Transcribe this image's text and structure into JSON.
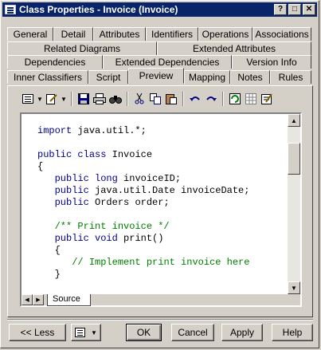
{
  "window": {
    "title": "Class Properties - Invoice (Invoice)",
    "controls": {
      "help": "?",
      "maximize": "□",
      "close": "✕"
    }
  },
  "tabs": {
    "row1": [
      "General",
      "Detail",
      "Attributes",
      "Identifiers",
      "Operations",
      "Associations"
    ],
    "row2": [
      "Related Diagrams",
      "Extended Attributes"
    ],
    "row3": [
      "Dependencies",
      "Extended Dependencies",
      "Version Info"
    ],
    "row4": [
      "Inner Classifiers",
      "Script",
      "Preview",
      "Mapping",
      "Notes",
      "Rules"
    ],
    "active": "Preview"
  },
  "toolbar": {
    "icons": [
      "list-menu-icon",
      "edit-menu-icon",
      "save-icon",
      "print-icon",
      "find-icon",
      "cut-icon",
      "copy-icon",
      "paste-icon",
      "undo-icon",
      "redo-icon",
      "refresh-icon",
      "grid-icon",
      "properties-icon"
    ]
  },
  "code": {
    "lines": [
      {
        "parts": [
          [
            "kw",
            "import"
          ],
          [
            "t",
            " java.util.*;"
          ]
        ]
      },
      {
        "parts": [
          [
            "t",
            ""
          ]
        ]
      },
      {
        "parts": [
          [
            "kw",
            "public"
          ],
          [
            "t",
            " "
          ],
          [
            "kw",
            "class"
          ],
          [
            "t",
            " Invoice"
          ]
        ]
      },
      {
        "parts": [
          [
            "t",
            "{"
          ]
        ]
      },
      {
        "parts": [
          [
            "t",
            "   "
          ],
          [
            "kw",
            "public"
          ],
          [
            "t",
            " "
          ],
          [
            "kw",
            "long"
          ],
          [
            "t",
            " invoiceID;"
          ]
        ]
      },
      {
        "parts": [
          [
            "t",
            "   "
          ],
          [
            "kw",
            "public"
          ],
          [
            "t",
            " java.util.Date invoiceDate;"
          ]
        ]
      },
      {
        "parts": [
          [
            "t",
            "   "
          ],
          [
            "kw",
            "public"
          ],
          [
            "t",
            " Orders order;"
          ]
        ]
      },
      {
        "parts": [
          [
            "t",
            ""
          ]
        ]
      },
      {
        "parts": [
          [
            "t",
            "   "
          ],
          [
            "cm",
            "/** Print invoice */"
          ]
        ]
      },
      {
        "parts": [
          [
            "t",
            "   "
          ],
          [
            "kw",
            "public"
          ],
          [
            "t",
            " "
          ],
          [
            "kw",
            "void"
          ],
          [
            "t",
            " print()"
          ]
        ]
      },
      {
        "parts": [
          [
            "t",
            "   {"
          ]
        ]
      },
      {
        "parts": [
          [
            "t",
            "      "
          ],
          [
            "cm",
            "// Implement print invoice here"
          ]
        ]
      },
      {
        "parts": [
          [
            "t",
            "   }"
          ]
        ]
      }
    ]
  },
  "editor": {
    "source_tab": "Source"
  },
  "buttons": {
    "less": "<< Less",
    "ok": "OK",
    "cancel": "Cancel",
    "apply": "Apply",
    "help": "Help"
  }
}
